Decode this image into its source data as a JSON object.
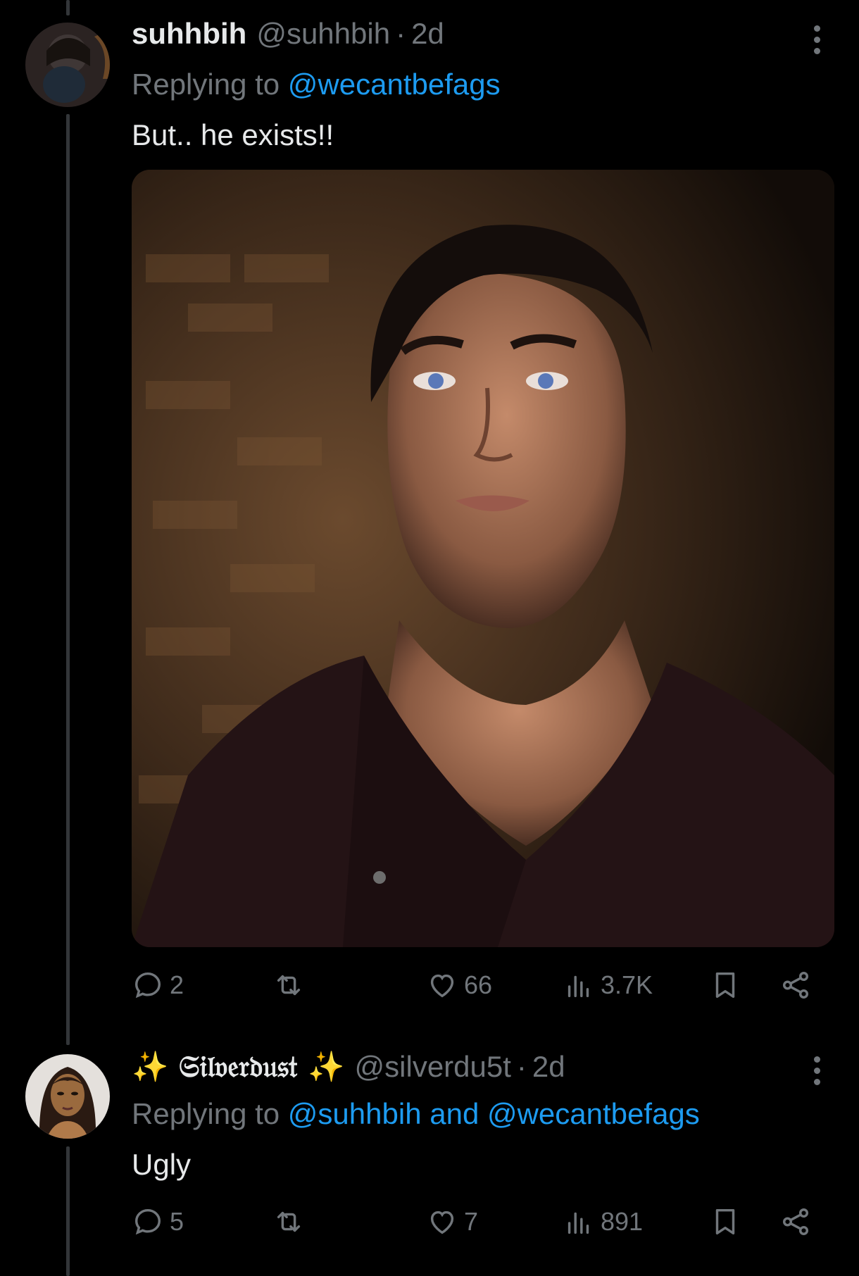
{
  "tweets": [
    {
      "display_name": "suhhbih",
      "handle": "@suhhbih",
      "separator": "·",
      "time": "2d",
      "replying_prefix": "Replying to",
      "replying_to": "@wecantbefags",
      "text": "But.. he exists!!",
      "media": "photo of a dark-haired man with blue eyes in a dark shirt",
      "stats": {
        "replies": "2",
        "likes": "66",
        "views": "3.7K"
      }
    },
    {
      "display_name": "✨ 𝔖𝔦𝔩𝔳𝔢𝔯𝔡𝔲𝔰𝔱 ✨",
      "handle": "@silverdu5t",
      "separator": "·",
      "time": "2d",
      "replying_prefix": "Replying to",
      "replying_to": "@suhhbih and @wecantbefags",
      "text": "Ugly",
      "stats": {
        "replies": "5",
        "likes": "7",
        "views": "891"
      }
    }
  ],
  "icons": [
    "reply-icon",
    "retweet-icon",
    "like-icon",
    "views-icon",
    "bookmark-icon",
    "share-icon",
    "more-icon"
  ],
  "colors": {
    "background": "#000000",
    "text": "#e7e9ea",
    "muted": "#71767b",
    "link": "#1d9bf0"
  }
}
